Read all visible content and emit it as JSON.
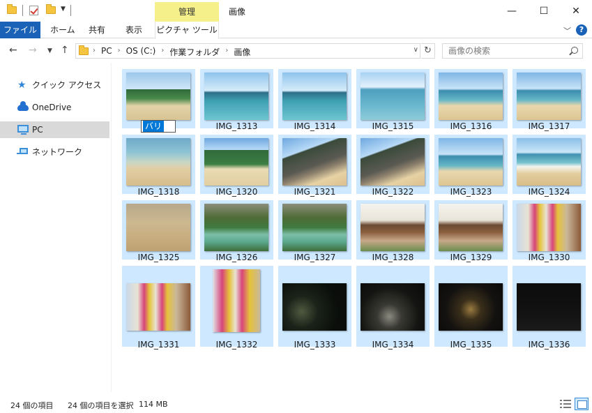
{
  "window": {
    "title": "画像",
    "context_tab": "管理",
    "controls": {
      "minimize": "—",
      "maximize": "☐",
      "close": "✕"
    }
  },
  "ribbon": {
    "tabs": [
      "ファイル",
      "ホーム",
      "共有",
      "表示",
      "ピクチャ ツール"
    ],
    "file_tab_color": "#1a62b7",
    "manage_tab_color": "#f6f08b"
  },
  "address": {
    "crumbs": [
      "PC",
      "OS (C:)",
      "作業フォルダ",
      "画像"
    ],
    "search_placeholder": "画像の検索"
  },
  "nav_pane": {
    "items": [
      {
        "label": "クイック アクセス",
        "icon": "star-icon"
      },
      {
        "label": "OneDrive",
        "icon": "cloud-icon"
      },
      {
        "label": "PC",
        "icon": "computer-icon"
      },
      {
        "label": "ネットワーク",
        "icon": "network-icon"
      }
    ],
    "selected": "PC"
  },
  "files": [
    {
      "name": "バリ",
      "renaming": true,
      "scene": "beach-trees"
    },
    {
      "name": "IMG_1313",
      "scene": "sea-island"
    },
    {
      "name": "IMG_1314",
      "scene": "sea-island"
    },
    {
      "name": "IMG_1315",
      "scene": "sea-people"
    },
    {
      "name": "IMG_1316",
      "scene": "sea-beach"
    },
    {
      "name": "IMG_1317",
      "scene": "sea-beach"
    },
    {
      "name": "IMG_1318",
      "scene": "sand-sea"
    },
    {
      "name": "IMG_1320",
      "scene": "beach-trees-people"
    },
    {
      "name": "IMG_1321",
      "scene": "rocks-beach"
    },
    {
      "name": "IMG_1322",
      "scene": "rocks-beach"
    },
    {
      "name": "IMG_1323",
      "scene": "sea-beach"
    },
    {
      "name": "IMG_1324",
      "scene": "waves-beach"
    },
    {
      "name": "IMG_1325",
      "scene": "sand"
    },
    {
      "name": "IMG_1326",
      "scene": "garden-pond"
    },
    {
      "name": "IMG_1327",
      "scene": "garden-pond"
    },
    {
      "name": "IMG_1328",
      "scene": "pavilion"
    },
    {
      "name": "IMG_1329",
      "scene": "pavilion"
    },
    {
      "name": "IMG_1330",
      "scene": "dancers"
    },
    {
      "name": "IMG_1331",
      "scene": "dancers"
    },
    {
      "name": "IMG_1332",
      "scene": "dancers-portrait"
    },
    {
      "name": "IMG_1333",
      "scene": "night-pool"
    },
    {
      "name": "IMG_1334",
      "scene": "night-wall"
    },
    {
      "name": "IMG_1335",
      "scene": "night-lights"
    },
    {
      "name": "IMG_1336",
      "scene": "night-dark"
    }
  ],
  "status": {
    "count": "24 個の項目",
    "selected": "24 個の項目を選択",
    "size": "114 MB"
  },
  "colors": {
    "selection": "#cde8ff",
    "accent": "#0078d7"
  }
}
